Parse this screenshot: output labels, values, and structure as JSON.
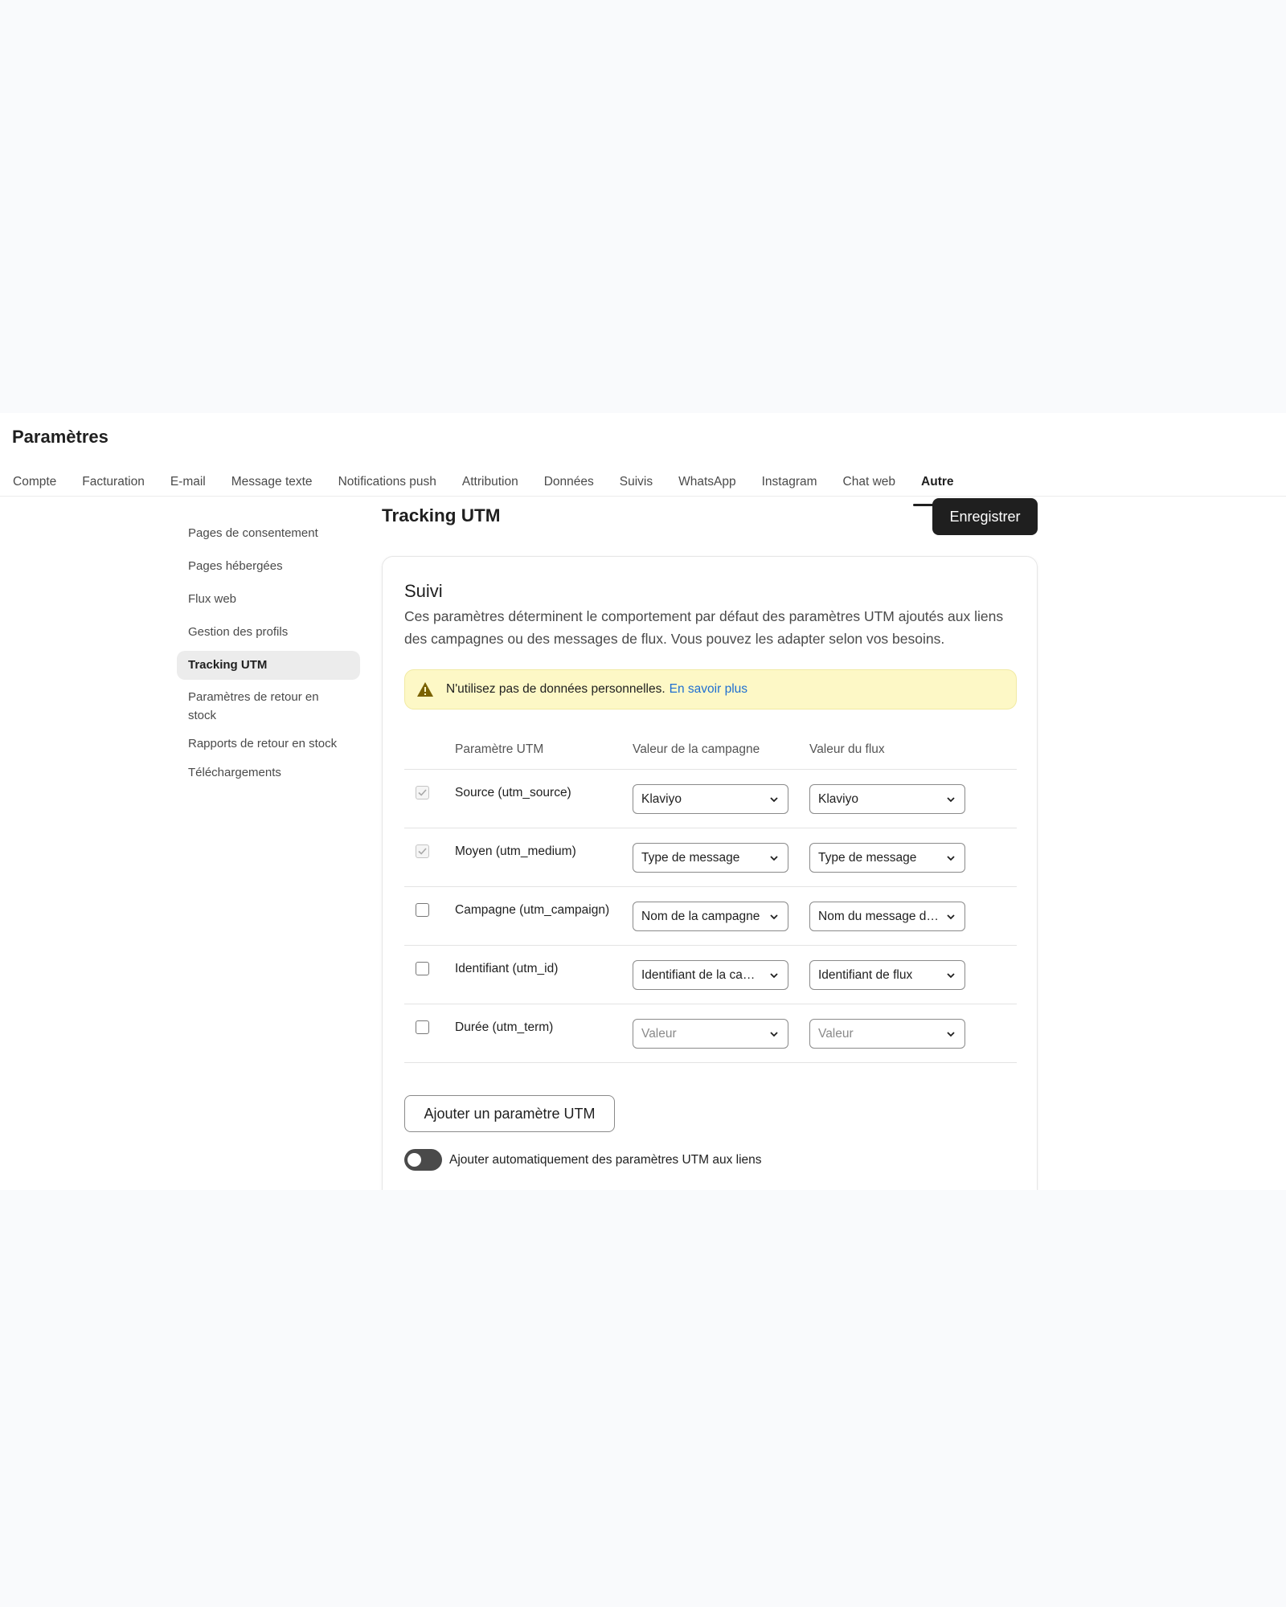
{
  "header": {
    "title": "Paramètres"
  },
  "tabs": [
    {
      "label": "Compte"
    },
    {
      "label": "Facturation"
    },
    {
      "label": "E-mail"
    },
    {
      "label": "Message texte"
    },
    {
      "label": "Notifications push"
    },
    {
      "label": "Attribution"
    },
    {
      "label": "Données"
    },
    {
      "label": "Suivis"
    },
    {
      "label": "WhatsApp"
    },
    {
      "label": "Instagram"
    },
    {
      "label": "Chat web"
    },
    {
      "label": "Autre",
      "active": true
    }
  ],
  "sidebar": {
    "items": [
      {
        "label": "Pages de consentement"
      },
      {
        "label": "Pages hébergées"
      },
      {
        "label": "Flux web"
      },
      {
        "label": "Gestion des profils"
      },
      {
        "label": "Tracking UTM",
        "active": true
      },
      {
        "label": "Paramètres de retour en stock"
      },
      {
        "label": "Rapports de retour en stock"
      },
      {
        "label": "Téléchargements"
      }
    ]
  },
  "main": {
    "title": "Tracking UTM",
    "save_label": "Enregistrer",
    "card": {
      "title": "Suivi",
      "description": "Ces paramètres déterminent le comportement par défaut des paramètres UTM ajoutés aux liens des campagnes ou des messages de flux. Vous pouvez les adapter selon vos besoins.",
      "warning": {
        "text": "N'utilisez pas de données personnelles.",
        "link": "En savoir plus",
        "icon": "warning-icon",
        "color": "#fdf8c6"
      },
      "table": {
        "headers": [
          "Paramètre UTM",
          "Valeur de la campagne",
          "Valeur du flux"
        ],
        "rows": [
          {
            "checked": true,
            "disabled": true,
            "name": "Source (utm_source)",
            "campaign": "Klaviyo",
            "flow": "Klaviyo",
            "placeholder": false
          },
          {
            "checked": true,
            "disabled": true,
            "name": "Moyen (utm_medium)",
            "campaign": "Type de message",
            "flow": "Type de message",
            "placeholder": false
          },
          {
            "checked": false,
            "disabled": false,
            "name": "Campagne (utm_campaign)",
            "campaign": "Nom de la campagne",
            "flow": "Nom du message de flux",
            "placeholder": false
          },
          {
            "checked": false,
            "disabled": false,
            "name": "Identifiant (utm_id)",
            "campaign": "Identifiant de la campagne",
            "flow": "Identifiant de flux",
            "placeholder": false
          },
          {
            "checked": false,
            "disabled": false,
            "name": "Durée (utm_term)",
            "campaign": "Valeur",
            "flow": "Valeur",
            "placeholder": true
          }
        ]
      },
      "add_button_label": "Ajouter un paramètre UTM",
      "toggle": {
        "label": "Ajouter automatiquement des paramètres UTM aux liens",
        "on": false
      }
    }
  },
  "colors": {
    "primary_button": "#1f1f1f",
    "link": "#1f6fd1",
    "warning_bg": "#fdf8c6",
    "warning_icon": "#7a6200"
  }
}
